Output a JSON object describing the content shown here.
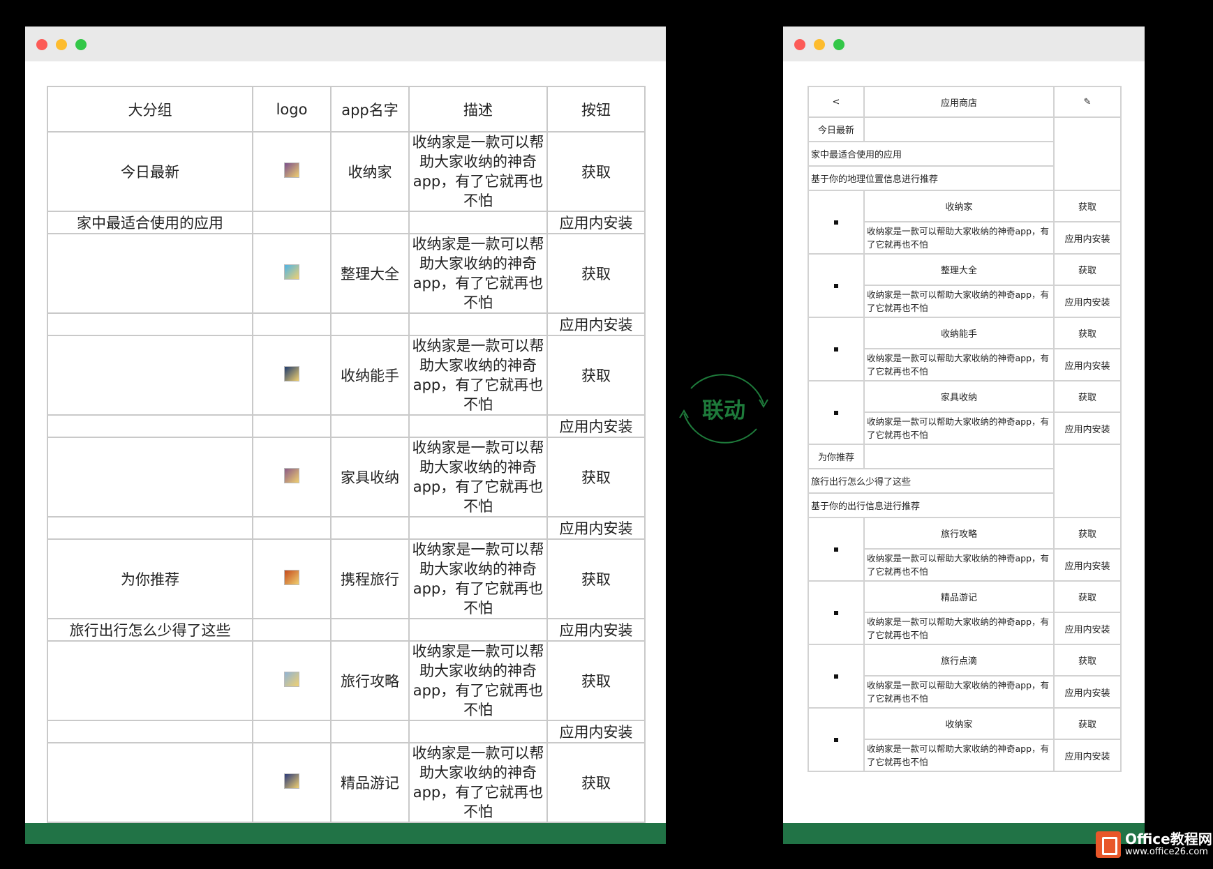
{
  "left": {
    "headers": [
      "大分组",
      "logo",
      "app名字",
      "描述",
      "按钮"
    ],
    "rows": [
      {
        "group": "今日最新",
        "logo_color": "#7a4f8c",
        "name": "收纳家",
        "desc": "收纳家是一款可以帮助大家收纳的神奇app，有了它就再也不怕",
        "btn": "获取",
        "sub_group": "家中最适合使用的应用",
        "sub_btn": "应用内安装"
      },
      {
        "group": "",
        "logo_color": "#4db3e6",
        "name": "整理大全",
        "desc": "收纳家是一款可以帮助大家收纳的神奇app，有了它就再也不怕",
        "btn": "获取",
        "sub_group": "",
        "sub_btn": "应用内安装"
      },
      {
        "group": "",
        "logo_color": "#1e3a6e",
        "name": "收纳能手",
        "desc": "收纳家是一款可以帮助大家收纳的神奇app，有了它就再也不怕",
        "btn": "获取",
        "sub_group": "",
        "sub_btn": "应用内安装"
      },
      {
        "group": "",
        "logo_color": "#8a5a86",
        "name": "家具收纳",
        "desc": "收纳家是一款可以帮助大家收纳的神奇app，有了它就再也不怕",
        "btn": "获取",
        "sub_group": "",
        "sub_btn": "应用内安装"
      },
      {
        "group": "为你推荐",
        "logo_color": "#c44a1c",
        "name": "携程旅行",
        "desc": "收纳家是一款可以帮助大家收纳的神奇app，有了它就再也不怕",
        "btn": "获取",
        "sub_group": "旅行出行怎么少得了这些",
        "sub_btn": "应用内安装"
      },
      {
        "group": "",
        "logo_color": "#8fb3d6",
        "name": "旅行攻略",
        "desc": "收纳家是一款可以帮助大家收纳的神奇app，有了它就再也不怕",
        "btn": "获取",
        "sub_group": "",
        "sub_btn": "应用内安装"
      },
      {
        "group": "",
        "logo_color": "#2a3a7a",
        "name": "精品游记",
        "desc": "收纳家是一款可以帮助大家收纳的神奇app，有了它就再也不怕",
        "btn": "获取",
        "sub_group": null,
        "sub_btn": null
      }
    ]
  },
  "link_label": "联动",
  "right": {
    "header": {
      "back": "<",
      "title": "应用商店",
      "edit": "✎"
    },
    "sections": [
      {
        "title": "今日最新",
        "subtitle": "家中最适合使用的应用",
        "note": "基于你的地理位置信息进行推荐",
        "apps": [
          {
            "name": "收纳家",
            "btn": "获取",
            "desc": "收纳家是一款可以帮助大家收纳的神奇app，有了它就再也不怕",
            "sub_btn": "应用内安装"
          },
          {
            "name": "整理大全",
            "btn": "获取",
            "desc": "收纳家是一款可以帮助大家收纳的神奇app，有了它就再也不怕",
            "sub_btn": "应用内安装"
          },
          {
            "name": "收纳能手",
            "btn": "获取",
            "desc": "收纳家是一款可以帮助大家收纳的神奇app，有了它就再也不怕",
            "sub_btn": "应用内安装"
          },
          {
            "name": "家具收纳",
            "btn": "获取",
            "desc": "收纳家是一款可以帮助大家收纳的神奇app，有了它就再也不怕",
            "sub_btn": "应用内安装"
          }
        ]
      },
      {
        "title": "为你推荐",
        "subtitle": "旅行出行怎么少得了这些",
        "note": "基于你的出行信息进行推荐",
        "apps": [
          {
            "name": "旅行攻略",
            "btn": "获取",
            "desc": "收纳家是一款可以帮助大家收纳的神奇app，有了它就再也不怕",
            "sub_btn": "应用内安装"
          },
          {
            "name": "精品游记",
            "btn": "获取",
            "desc": "收纳家是一款可以帮助大家收纳的神奇app，有了它就再也不怕",
            "sub_btn": "应用内安装"
          },
          {
            "name": "旅行点滴",
            "btn": "获取",
            "desc": "收纳家是一款可以帮助大家收纳的神奇app，有了它就再也不怕",
            "sub_btn": "应用内安装"
          },
          {
            "name": "收纳家",
            "btn": "获取",
            "desc": "收纳家是一款可以帮助大家收纳的神奇app，有了它就再也不怕",
            "sub_btn": "应用内安装"
          }
        ]
      }
    ]
  },
  "brand": {
    "name": "Office教程网",
    "url": "www.office26.com"
  }
}
